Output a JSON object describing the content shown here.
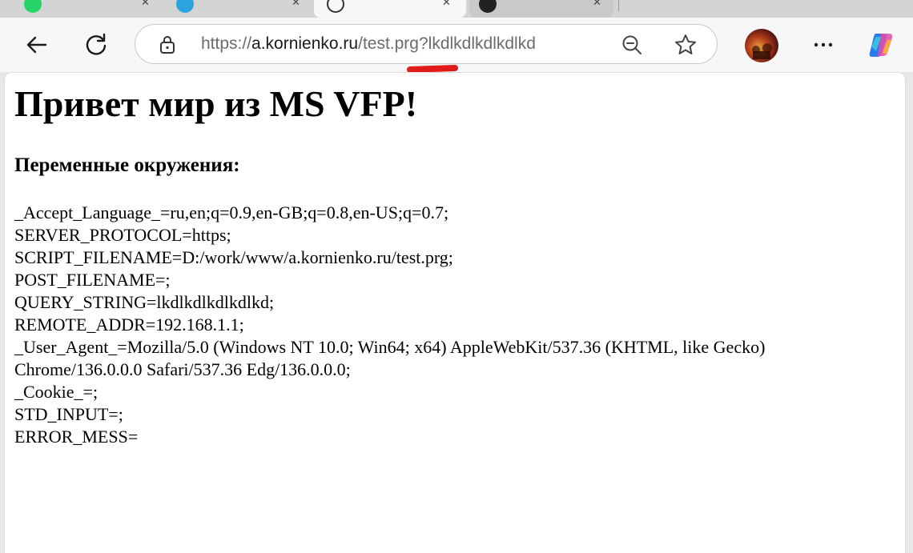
{
  "browser": {
    "url": {
      "scheme": "https://",
      "host": "a.kornienko.ru",
      "path": "/test.prg?lkdlkdlkdlkdlkd"
    },
    "icons": {
      "back": "arrow-left-icon",
      "reload": "reload-icon",
      "site_info": "lock-icon",
      "zoom": "zoom-out-icon",
      "favorite": "star-icon",
      "more": "more-dots-icon",
      "copilot": "copilot-icon"
    },
    "accent_mark_color": "#e11a1a"
  },
  "page": {
    "heading": "Привет мир из MS VFP!",
    "subheading": "Переменные окружения:",
    "env_lines": [
      "_Accept_Language_=ru,en;q=0.9,en-GB;q=0.8,en-US;q=0.7;",
      "SERVER_PROTOCOL=https;",
      "SCRIPT_FILENAME=D:/work/www/a.kornienko.ru/test.prg;",
      "POST_FILENAME=;",
      "QUERY_STRING=lkdlkdlkdlkdlkd;",
      "REMOTE_ADDR=192.168.1.1;",
      "_User_Agent_=Mozilla/5.0 (Windows NT 10.0; Win64; x64) AppleWebKit/537.36 (KHTML, like Gecko)",
      "Chrome/136.0.0.0 Safari/537.36 Edg/136.0.0.0;",
      "_Cookie_=;",
      "STD_INPUT=;",
      "ERROR_MESS="
    ]
  }
}
